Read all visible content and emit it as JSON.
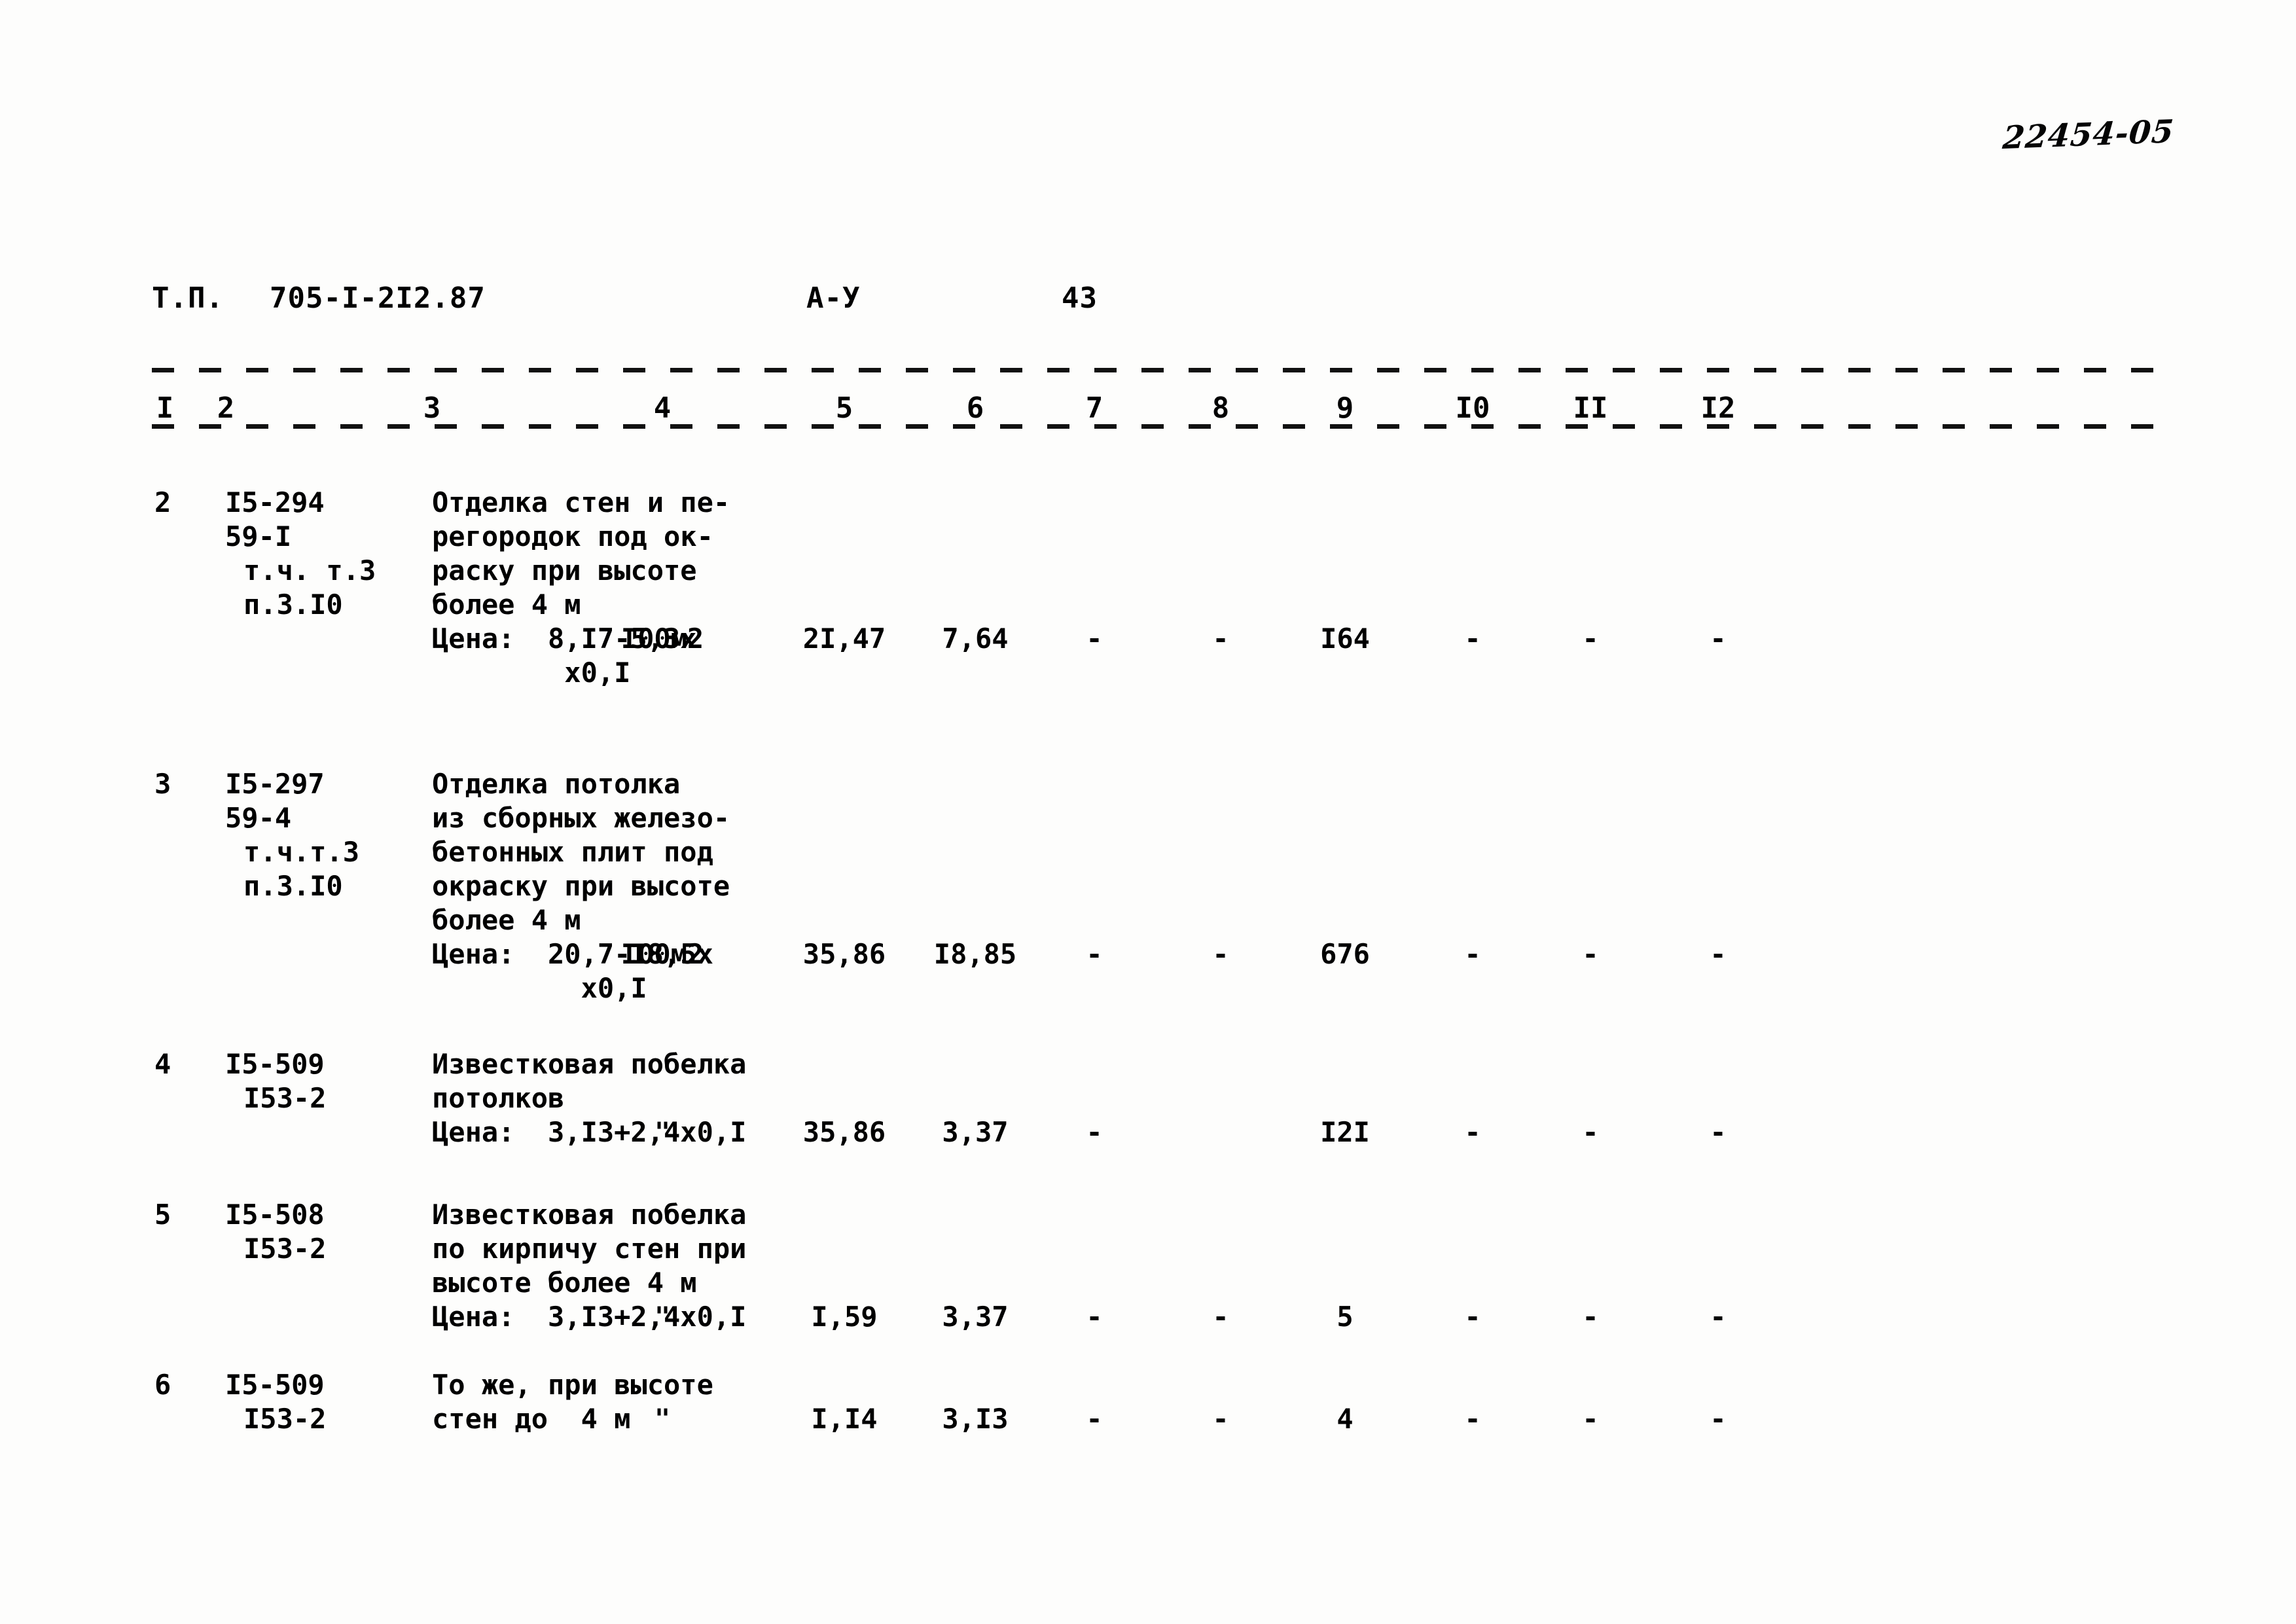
{
  "annotation": {
    "archive_number": "22454-05"
  },
  "header": {
    "prefix": "Т.П.",
    "project_code": "705-I-2I2.87",
    "series": "А-У",
    "page": "43"
  },
  "column_numbers": [
    "I",
    "2",
    "3",
    "4",
    "5",
    "6",
    "7",
    "8",
    "9",
    "I0",
    "II",
    "I2"
  ],
  "rows": [
    {
      "no": "2",
      "codes": [
        "I5-294",
        "59-I",
        "т.ч. т.3",
        "п.3.I0"
      ],
      "description": [
        "Отделка стен и пе-",
        "регородок под ок-",
        "раску при высоте",
        "более 4 м",
        "Цена:  8,I7-5,3х",
        "        х0,I"
      ],
      "unit": "I00м2",
      "c6": "2I,47",
      "c7": "7,64",
      "c8": "-",
      "c9": "-",
      "c10": "I64",
      "c11": "-",
      "c12": "-",
      "c13": "-"
    },
    {
      "no": "3",
      "codes": [
        "I5-297",
        "59-4",
        "т.ч.т.3",
        "п.3.I0"
      ],
      "description": [
        "Отделка потолка",
        "из сборных железо-",
        "бетонных плит под",
        "окраску при высоте",
        "более 4 м",
        "Цена:  20,7-I8,5х",
        "         х0,I"
      ],
      "unit": "I00м2",
      "c6": "35,86",
      "c7": "I8,85",
      "c8": "-",
      "c9": "-",
      "c10": "676",
      "c11": "-",
      "c12": "-",
      "c13": "-"
    },
    {
      "no": "4",
      "codes": [
        "I5-509",
        "I53-2"
      ],
      "description": [
        "Известковая побелка",
        "потолков",
        "Цена:  3,I3+2,4х0,I"
      ],
      "unit": "\"",
      "c6": "35,86",
      "c7": "3,37",
      "c8": "-",
      "c9": "",
      "c10": "I2I",
      "c11": "-",
      "c12": "-",
      "c13": "-"
    },
    {
      "no": "5",
      "codes": [
        "I5-508",
        "I53-2"
      ],
      "description": [
        "Известковая побелка",
        "по кирпичу стен при",
        "высоте более 4 м",
        "Цена:  3,I3+2,4х0,I"
      ],
      "unit": "\"",
      "c6": "I,59",
      "c7": "3,37",
      "c8": "-",
      "c9": "-",
      "c10": "5",
      "c11": "-",
      "c12": "-",
      "c13": "-"
    },
    {
      "no": "6",
      "codes": [
        "I5-509",
        "I53-2"
      ],
      "description": [
        "То же, при высоте",
        "стен до  4 м"
      ],
      "unit": "\"",
      "c6": "I,I4",
      "c7": "3,I3",
      "c8": "-",
      "c9": "-",
      "c10": "4",
      "c11": "-",
      "c12": "-",
      "c13": "-"
    }
  ]
}
